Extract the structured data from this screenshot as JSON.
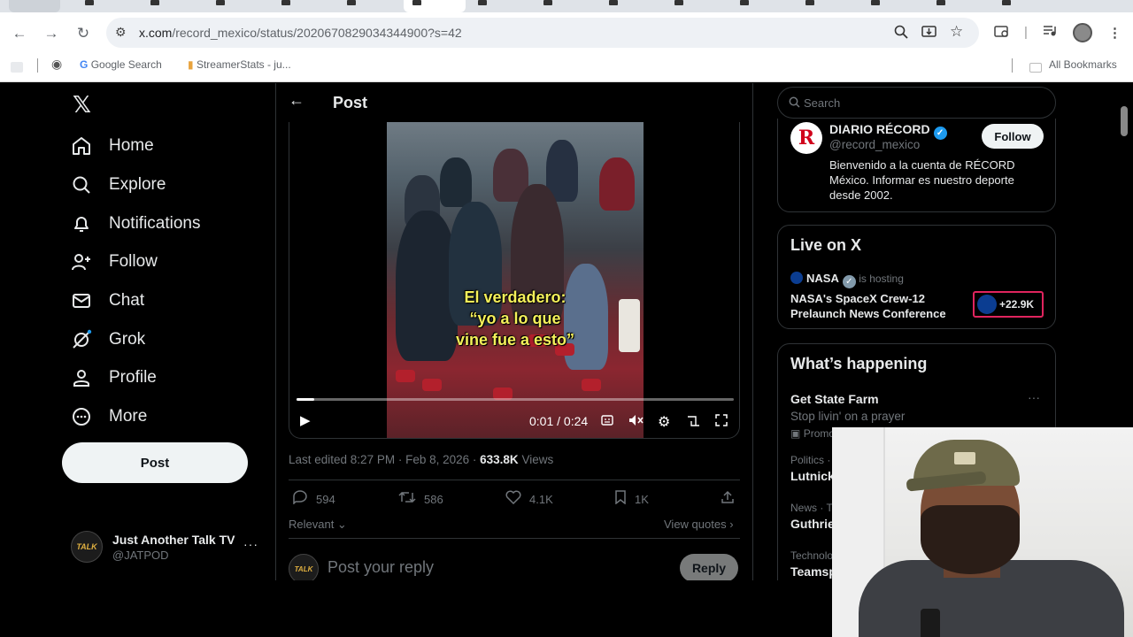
{
  "browser": {
    "url_host": "x.com",
    "url_path": "/record_mexico/status/2020670829034344900?s=42",
    "bookmarks": {
      "google_search": "Google Search",
      "streamerstats": "StreamerStats - ju...",
      "all_bookmarks": "All Bookmarks"
    },
    "icons": [
      "back-icon",
      "forward-icon",
      "reload-icon",
      "site-settings-icon",
      "zoom-icon",
      "install-icon",
      "star-icon",
      "tab-search-icon",
      "media-icon",
      "profile-icon",
      "menu-icon"
    ]
  },
  "sidebar": {
    "logo": "𝕏",
    "items": [
      {
        "label": "Home",
        "icon": "home-icon"
      },
      {
        "label": "Explore",
        "icon": "search-icon"
      },
      {
        "label": "Notifications",
        "icon": "bell-icon"
      },
      {
        "label": "Follow",
        "icon": "add-user-icon"
      },
      {
        "label": "Chat",
        "icon": "mail-icon"
      },
      {
        "label": "Grok",
        "icon": "grok-icon"
      },
      {
        "label": "Profile",
        "icon": "person-icon"
      },
      {
        "label": "More",
        "icon": "more-circle-icon"
      }
    ],
    "post_button": "Post",
    "account": {
      "name": "Just Another Talk TV",
      "handle": "@JATPOD",
      "avatar_text": "TALK",
      "more": "···"
    }
  },
  "main": {
    "header_title": "Post",
    "video": {
      "caption_line1": "El verdadero:",
      "caption_line2": "“yo a lo que",
      "caption_line3": "vine fue a esto”",
      "time": "0:01 / 0:24",
      "progress": 0.04
    },
    "meta": {
      "edited": "Last edited 8:27 PM · Feb 8, 2026 · ",
      "views_count": "633.8K",
      "views_label": " Views"
    },
    "actions": {
      "replies": "594",
      "reposts": "586",
      "likes": "4.1K",
      "bookmarks": "1K"
    },
    "relevant": "Relevant",
    "view_quotes": "View quotes",
    "reply": {
      "placeholder": "Post your reply",
      "button": "Reply",
      "avatar_text": "TALK"
    }
  },
  "right": {
    "search_placeholder": "Search",
    "profile_card": {
      "logo": "R",
      "name": "DIARIO RÉCORD",
      "handle": "@record_mexico",
      "follow": "Follow",
      "bio": "Bienvenido a la cuenta de RÉCORD México. Informar es nuestro deporte desde 2002."
    },
    "live": {
      "title": "Live on X",
      "host": "NASA",
      "hosting": "is hosting",
      "event": "NASA's SpaceX Crew-12 Prelaunch News Conference",
      "listeners": "+22.9K"
    },
    "happening": {
      "title": "What’s happening",
      "promo_title": "Get State Farm",
      "promo_sub": "Stop livin' on a prayer",
      "promo_label": "Promo",
      "trends": [
        {
          "category": "Politics · ",
          "name": "Lutnick"
        },
        {
          "category": "News · Tr",
          "name": "Guthrie"
        },
        {
          "category": "Technolo",
          "name": "Teamsp"
        }
      ]
    }
  }
}
